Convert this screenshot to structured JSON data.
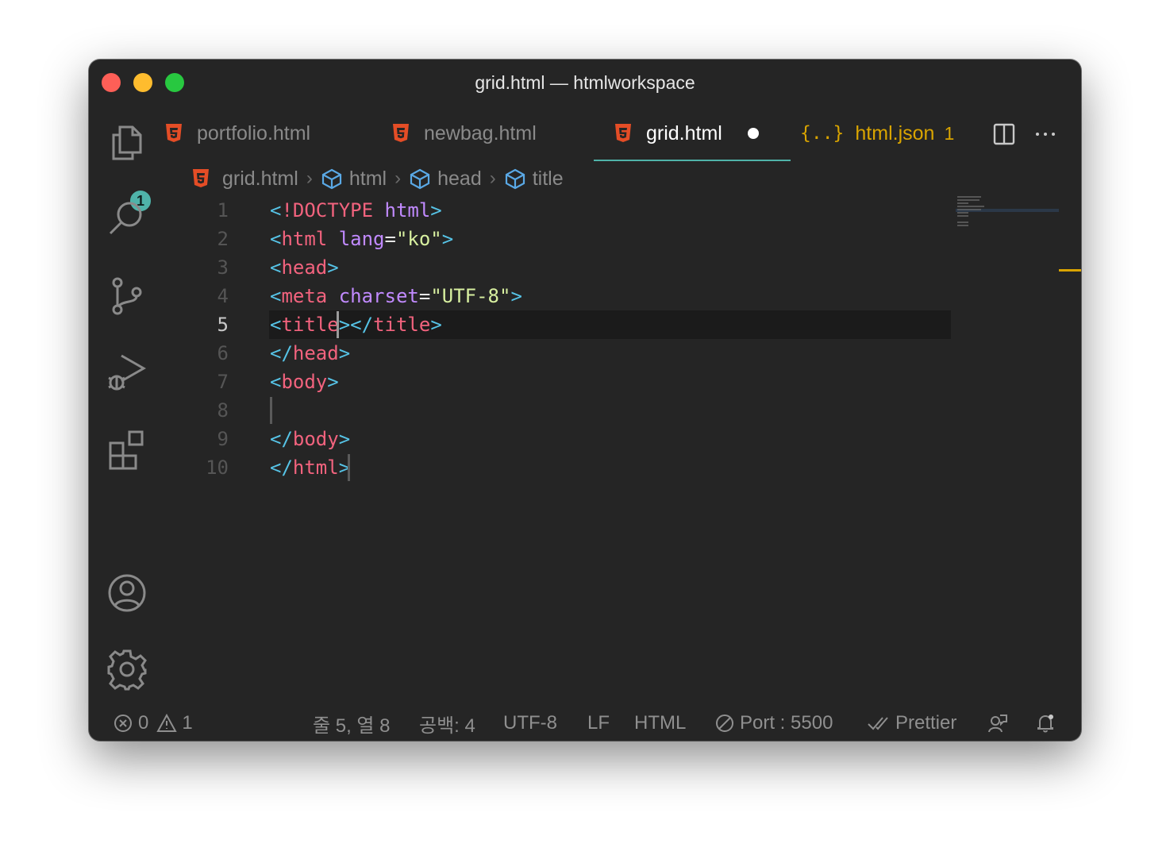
{
  "window": {
    "title": "grid.html — htmlworkspace"
  },
  "activity_bar": {
    "explorer_badge": "1"
  },
  "tabs": [
    {
      "label": "portfolio.html"
    },
    {
      "label": "newbag.html"
    },
    {
      "label": "grid.html"
    },
    {
      "label": "html.json",
      "problem_count": "1",
      "icon_text": "{..}"
    }
  ],
  "breadcrumb": [
    "grid.html",
    "html",
    "head",
    "title"
  ],
  "line_numbers": [
    "1",
    "2",
    "3",
    "4",
    "5",
    "6",
    "7",
    "8",
    "9",
    "10"
  ],
  "code": {
    "l1": {
      "open": "<",
      "decl": "!DOCTYPE",
      "sp": " ",
      "word": "html",
      "close": ">"
    },
    "l2": {
      "open": "<",
      "tag": "html",
      "sp": " ",
      "attr": "lang",
      "eq": "=",
      "val": "\"ko\"",
      "close": ">"
    },
    "l3": {
      "open": "<",
      "tag": "head",
      "close": ">"
    },
    "l4": {
      "open": "<",
      "tag": "meta",
      "sp": " ",
      "attr": "charset",
      "eq": "=",
      "val": "\"UTF-8\"",
      "close": ">"
    },
    "l5": {
      "open": "<",
      "tag": "title",
      "close": ">",
      "open2": "</",
      "tag2": "title",
      "close2": ">"
    },
    "l6": {
      "open": "</",
      "tag": "head",
      "close": ">"
    },
    "l7": {
      "open": "<",
      "tag": "body",
      "close": ">"
    },
    "l9": {
      "open": "</",
      "tag": "body",
      "close": ">"
    },
    "l10": {
      "open": "</",
      "tag": "html",
      "close": ">"
    }
  },
  "status_bar": {
    "errors": "0",
    "warnings": "1",
    "cursor_position": "줄 5, 열 8",
    "indentation": "공백: 4",
    "encoding": "UTF-8",
    "eol": "LF",
    "language": "HTML",
    "port": "Port : 5500",
    "formatter": "Prettier"
  },
  "colors": {
    "accent": "#4fb3a9",
    "warning": "#d9a400",
    "tag": "#f2637e",
    "punctuation": "#56c3e6",
    "attribute": "#c18aff",
    "string": "#d8f0a0"
  }
}
